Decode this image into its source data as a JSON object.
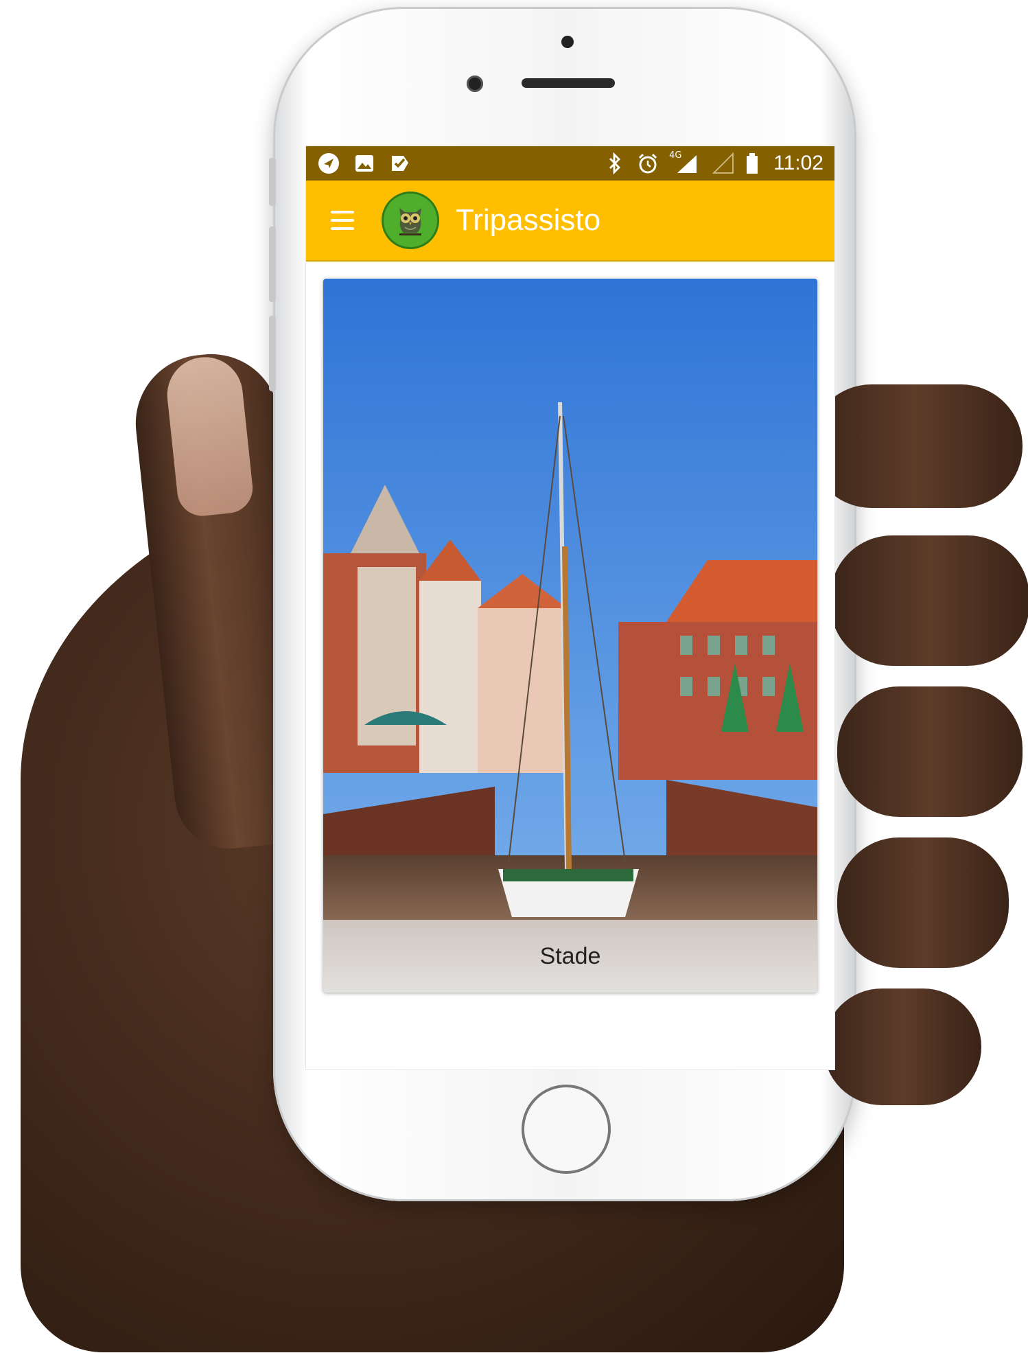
{
  "status_bar": {
    "left_icons": [
      "navigation-icon",
      "image-icon",
      "task-icon"
    ],
    "right_icons": [
      "bluetooth-icon",
      "alarm-icon",
      "4g-signal-icon",
      "signal-icon",
      "battery-icon"
    ],
    "network_label": "4G",
    "time": "11:02"
  },
  "app_bar": {
    "title": "Tripassisto",
    "logo": "owl-logo-icon",
    "menu_icon": "hamburger-menu-icon",
    "color": "#ffbf00"
  },
  "cards": [
    {
      "caption": "Stade",
      "image": "harbor-sailboat-photo"
    }
  ],
  "colors": {
    "status_bar": "#846000",
    "app_bar": "#ffbf00",
    "logo_bg": "#4fae2b"
  }
}
